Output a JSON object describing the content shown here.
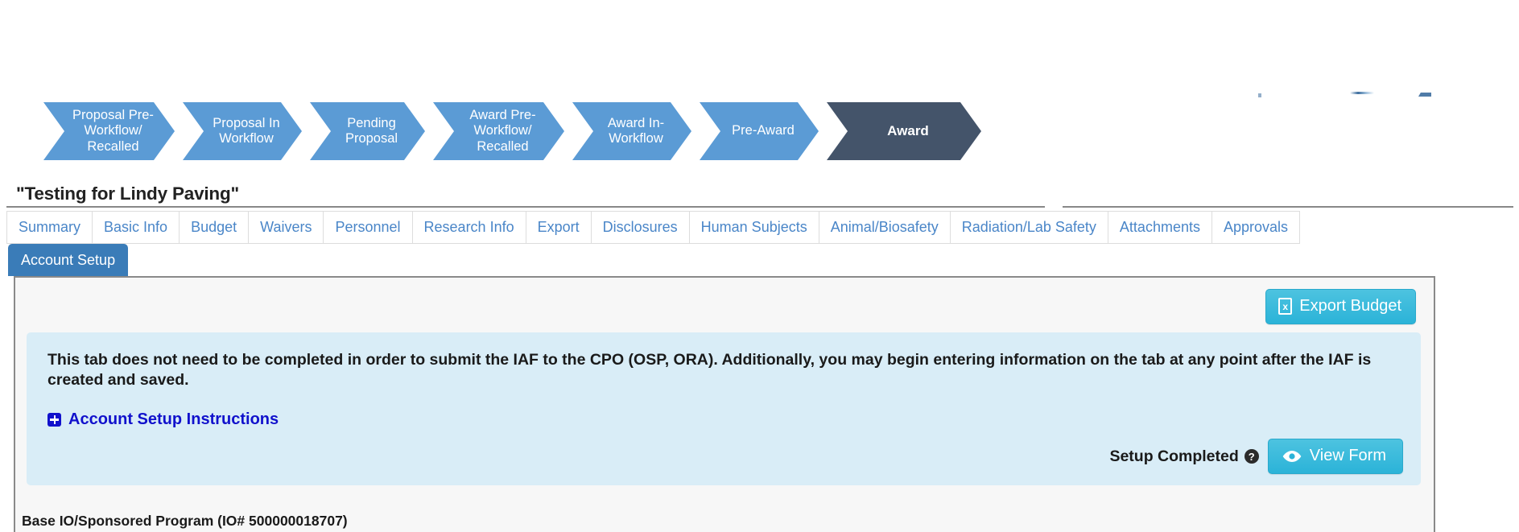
{
  "workflow": {
    "name": "award-workflow-progress",
    "steps": [
      {
        "label": "Proposal Pre-Workflow/\nRecalled",
        "state": "complete",
        "color": "#5b9bd5"
      },
      {
        "label": "Proposal In\nWorkflow",
        "state": "complete",
        "color": "#5b9bd5"
      },
      {
        "label": "Pending\nProposal",
        "state": "complete",
        "color": "#5b9bd5"
      },
      {
        "label": "Award Pre-Workflow/\nRecalled",
        "state": "complete",
        "color": "#5b9bd5"
      },
      {
        "label": "Award In-\nWorkflow",
        "state": "complete",
        "color": "#5b9bd5"
      },
      {
        "label": "Pre-Award",
        "state": "complete",
        "color": "#5b9bd5"
      },
      {
        "label": "Award",
        "state": "current",
        "color": "#44546a"
      }
    ]
  },
  "page": {
    "title": "\"Testing for Lindy Paving\""
  },
  "tabs": {
    "primary": [
      {
        "label": "Summary"
      },
      {
        "label": "Basic Info"
      },
      {
        "label": "Budget"
      },
      {
        "label": "Waivers"
      },
      {
        "label": "Personnel"
      },
      {
        "label": "Research Info"
      },
      {
        "label": "Export"
      },
      {
        "label": "Disclosures"
      },
      {
        "label": "Human Subjects"
      },
      {
        "label": "Animal/Biosafety"
      },
      {
        "label": "Radiation/Lab Safety"
      },
      {
        "label": "Attachments"
      },
      {
        "label": "Approvals"
      }
    ],
    "active_tab": "Account Setup"
  },
  "toolbar": {
    "export_budget_label": "Export Budget",
    "export_budget_icon": "excel-file-icon",
    "export_budget_icon_glyph": "x"
  },
  "info_panel": {
    "message": "This tab does not need to be completed in order to submit the IAF to the CPO (OSP, ORA). Additionally, you may begin entering information on the tab at any point after the IAF is created and saved.",
    "instructions_link": "Account Setup Instructions",
    "instructions_icon": "plus-square-icon",
    "setup_completed_label": "Setup Completed",
    "help_icon": "question-mark-help-icon",
    "help_glyph": "?",
    "view_form_label": "View Form",
    "view_form_icon": "eye-icon"
  },
  "section": {
    "base_io_label": "Base IO/Sponsored Program (IO# 500000018707)"
  },
  "colors": {
    "chevron_complete": "#5b9bd5",
    "chevron_current": "#44546a",
    "tab_link": "#4a86c8",
    "tab_active_bg": "#3a7cb8",
    "info_box_bg": "#d9edf7",
    "button_cyan": "#2bb3d8",
    "link_blue": "#1111cc"
  }
}
